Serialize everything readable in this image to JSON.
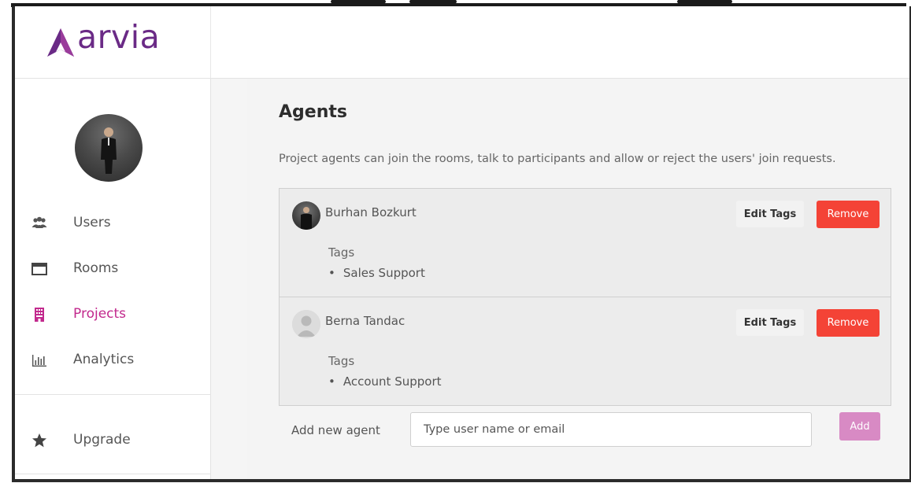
{
  "brand": {
    "name": "arvia",
    "color": "#6a2a86"
  },
  "sidebar": {
    "items": [
      {
        "label": "Users",
        "icon": "users-icon",
        "active": false
      },
      {
        "label": "Rooms",
        "icon": "window-icon",
        "active": false
      },
      {
        "label": "Projects",
        "icon": "building-icon",
        "active": true
      },
      {
        "label": "Analytics",
        "icon": "bar-chart-icon",
        "active": false
      }
    ],
    "upgrade": {
      "label": "Upgrade",
      "icon": "star-icon"
    },
    "active_color": "#c2298d"
  },
  "main": {
    "title": "Agents",
    "description": "Project agents can join the rooms, talk to participants and allow or reject the users' join requests.",
    "agents": [
      {
        "name": "Burhan Bozkurt",
        "avatar": "photo",
        "tags_label": "Tags",
        "tags": [
          "Sales Support"
        ]
      },
      {
        "name": "Berna Tandac",
        "avatar": "generic-user-icon",
        "tags_label": "Tags",
        "tags": [
          "Account Support"
        ]
      }
    ],
    "edit_tags_label": "Edit Tags",
    "remove_label": "Remove",
    "add_agent": {
      "label": "Add new agent",
      "placeholder": "Type user name or email",
      "button_label": "Add"
    },
    "remove_color": "#f44336",
    "add_color": "#d88ac4"
  }
}
